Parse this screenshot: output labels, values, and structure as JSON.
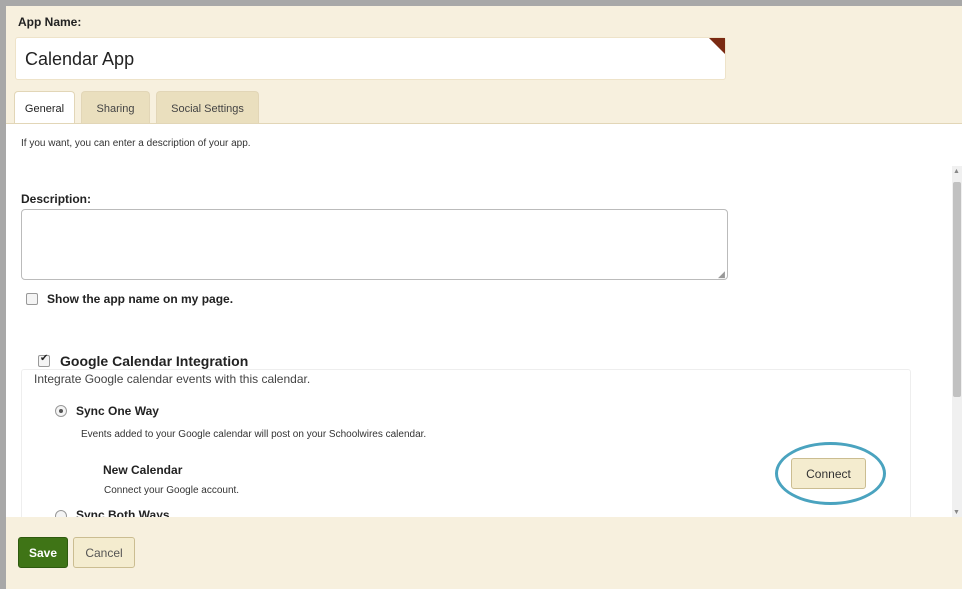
{
  "app_name": {
    "label": "App Name:",
    "value": "Calendar App"
  },
  "tabs": [
    {
      "label": "General",
      "active": true
    },
    {
      "label": "Sharing",
      "active": false
    },
    {
      "label": "Social Settings",
      "active": false
    }
  ],
  "general": {
    "intro": "If you want, you can enter a description of your app.",
    "description_label": "Description:",
    "description_value": "",
    "show_name_label": "Show the app name on my page.",
    "show_name_checked": false
  },
  "google_calendar": {
    "title": "Google Calendar Integration",
    "checked": true,
    "description": "Integrate Google calendar events with this calendar.",
    "sync_one_way": {
      "label": "Sync One Way",
      "selected": true,
      "description": "Events added to your Google calendar will post on your Schoolwires calendar."
    },
    "new_calendar": {
      "title": "New Calendar",
      "description": "Connect your Google account.",
      "connect_label": "Connect"
    },
    "sync_both_ways": {
      "label": "Sync Both Ways",
      "selected": false
    }
  },
  "footer": {
    "save_label": "Save",
    "cancel_label": "Cancel"
  },
  "colors": {
    "header_bg": "#f7f0de",
    "save_green": "#3f7416",
    "highlight_ring": "#4aa3bf",
    "corner_flag": "#7a2a12"
  }
}
